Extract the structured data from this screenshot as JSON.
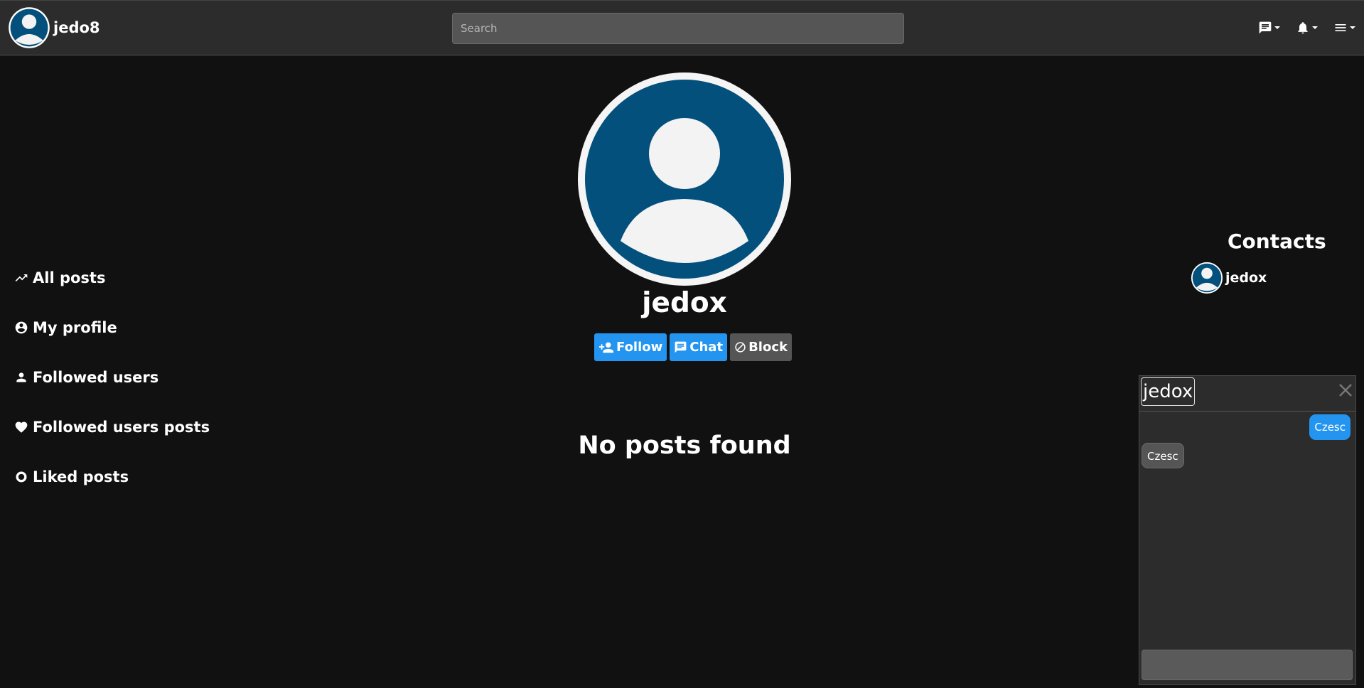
{
  "header": {
    "username": "jedo8",
    "search_placeholder": "Search",
    "icons": [
      "chat-icon",
      "bell-icon",
      "menu-icon"
    ]
  },
  "sidebar": {
    "items": [
      {
        "label": "All posts",
        "icon": "trending-icon"
      },
      {
        "label": "My profile",
        "icon": "account-circle-icon"
      },
      {
        "label": "Followed users",
        "icon": "person-icon"
      },
      {
        "label": "Followed users posts",
        "icon": "heart-icon"
      },
      {
        "label": "Liked posts",
        "icon": "donut-icon"
      }
    ]
  },
  "profile": {
    "name": "jedox",
    "follow_label": "Follow",
    "chat_label": "Chat",
    "block_label": "Block",
    "empty_message": "No posts found"
  },
  "contacts": {
    "title": "Contacts",
    "items": [
      {
        "name": "jedox"
      }
    ]
  },
  "chat": {
    "user": "jedox",
    "messages": [
      {
        "text": "Czesc",
        "direction": "outgoing"
      },
      {
        "text": "Czesc",
        "direction": "incoming"
      }
    ],
    "input_value": ""
  },
  "colors": {
    "background": "#111111",
    "topbar": "#2c2c2c",
    "accent": "#2395f1",
    "avatar_blue": "#03507c",
    "button_gray": "#555555"
  }
}
